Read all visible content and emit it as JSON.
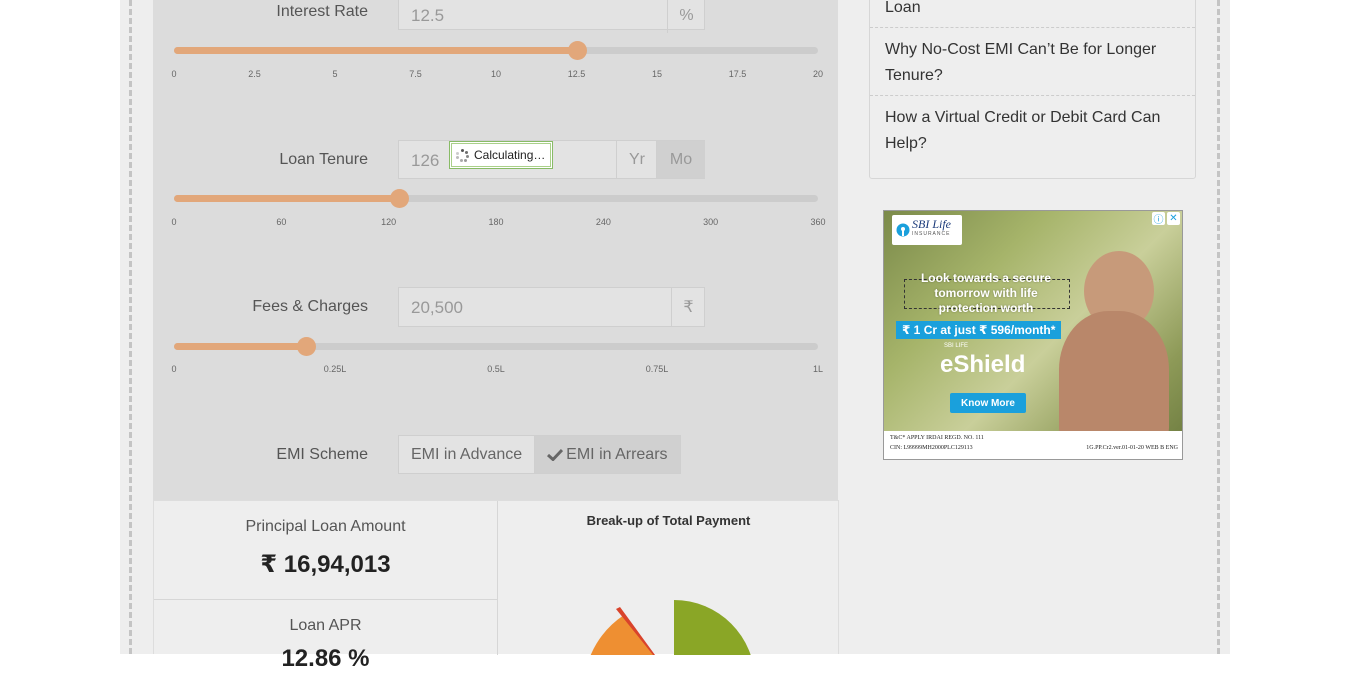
{
  "calculator": {
    "interest_rate": {
      "label": "Interest Rate",
      "value": "12.5",
      "unit": "%",
      "slider_fraction": 0.625,
      "ticks": [
        "0",
        "2.5",
        "5",
        "7.5",
        "10",
        "12.5",
        "15",
        "17.5",
        "20"
      ]
    },
    "loan_tenure": {
      "label": "Loan Tenure",
      "value": "126",
      "unit_year": "Yr",
      "unit_month": "Mo",
      "selected_unit": "Mo",
      "busy_text": "Calculating…",
      "slider_fraction": 0.35,
      "ticks": [
        "0",
        "60",
        "120",
        "180",
        "240",
        "300",
        "360"
      ]
    },
    "fees_charges": {
      "label": "Fees & Charges",
      "value": "20,500",
      "unit": "₹",
      "slider_fraction": 0.205,
      "ticks": [
        "0",
        "0.25L",
        "0.5L",
        "0.75L",
        "1L"
      ]
    },
    "emi_scheme": {
      "label": "EMI Scheme",
      "option_advance": "EMI in Advance",
      "option_arrears": "EMI in Arrears",
      "selected": "EMI in Arrears"
    }
  },
  "results": {
    "principal_label": "Principal Loan Amount",
    "principal_value": "₹ 16,94,013",
    "apr_label": "Loan APR",
    "apr_value": "12.86 %",
    "chart_title": "Break-up of Total Payment"
  },
  "sidebar": {
    "items": [
      "Loan",
      "Why No-Cost EMI Can’t Be for Longer Tenure?",
      "How a Virtual Credit or Debit Card Can Help?"
    ]
  },
  "ad": {
    "brand": "SBI Life",
    "brand_sub": "INSURANCE",
    "headline_1": "Look towards a secure",
    "headline_2": "tomorrow with life",
    "headline_3": "protection worth",
    "price": "₹ 1 Cr at just ₹ 596/month*",
    "product_small": "SBI LIFE",
    "product": "eShield",
    "cta": "Know More",
    "footer_1": "T&C* APPLY  IRDAI REGD. NO. 111",
    "footer_2": "CIN: L99999MH2000PLC129113",
    "footer_3": "1G.PP.Cr2.ver.01-01-20 WEB B ENG",
    "colors": {
      "accent": "#1aa0dc",
      "brand": "#1a3a7a"
    }
  },
  "colors": {
    "slider_fill": "#e2a77a",
    "pie_green": "#8aa626",
    "pie_orange": "#ee8f32",
    "pie_red": "#d9432b"
  }
}
